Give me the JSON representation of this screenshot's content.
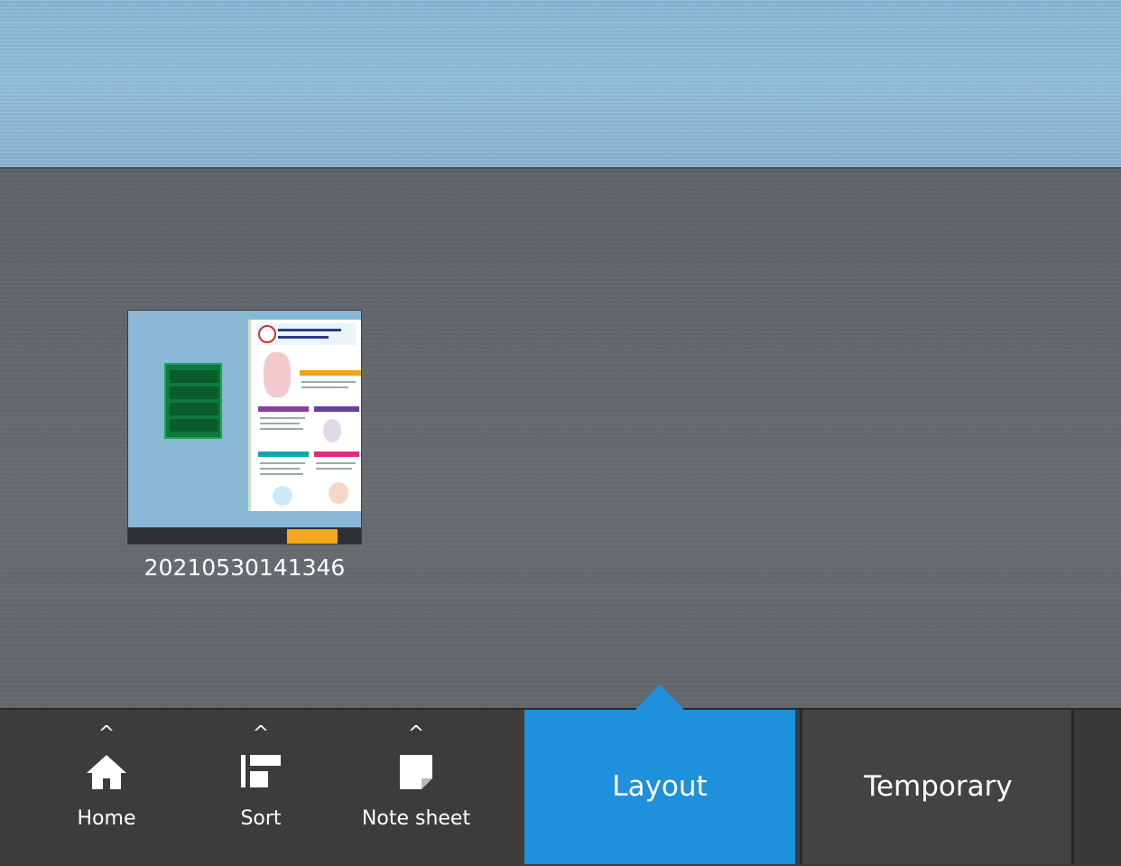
{
  "workspace": {
    "thumbnail": {
      "label": "20210530141346"
    }
  },
  "toolbar": {
    "home_label": "Home",
    "sort_label": "Sort",
    "note_label": "Note sheet",
    "expand_glyph": "^"
  },
  "tabs": {
    "layout_label": "Layout",
    "temporary_label": "Temporary",
    "active": "Layout"
  },
  "colors": {
    "accent": "#1e90dc",
    "toolbar_bg": "#3c3c3c",
    "workspace_bg": "#63686c",
    "top_band": "#8ab7d6"
  },
  "icons": {
    "home": "home-icon",
    "sort": "sort-icon",
    "note": "note-sheet-icon"
  }
}
